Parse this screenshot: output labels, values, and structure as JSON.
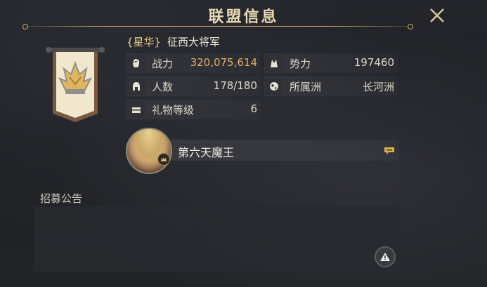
{
  "header": {
    "title": "联盟信息"
  },
  "alliance": {
    "tag": "{星华}",
    "name": "征西大将军"
  },
  "stats": {
    "power": {
      "label": "战力",
      "value": "320,075,614"
    },
    "influence": {
      "label": "势力",
      "value": "197460"
    },
    "members": {
      "label": "人数",
      "value": "178/180"
    },
    "region": {
      "label": "所属洲",
      "value": "长河洲"
    },
    "gift_level": {
      "label": "礼物等级",
      "value": "6"
    }
  },
  "leader": {
    "name": "第六天魔王"
  },
  "recruit": {
    "label": "招募公告",
    "text": ""
  },
  "colors": {
    "gold": "#e1b069",
    "title": "#e7d9b3",
    "accent_line": "#c9a86a"
  },
  "icons": [
    "close-icon",
    "alliance-banner-icon",
    "fist-icon",
    "influence-icon",
    "helmet-icon",
    "globe-icon",
    "gift-icon",
    "chat-icon",
    "warning-icon",
    "leader-crown-icon"
  ]
}
